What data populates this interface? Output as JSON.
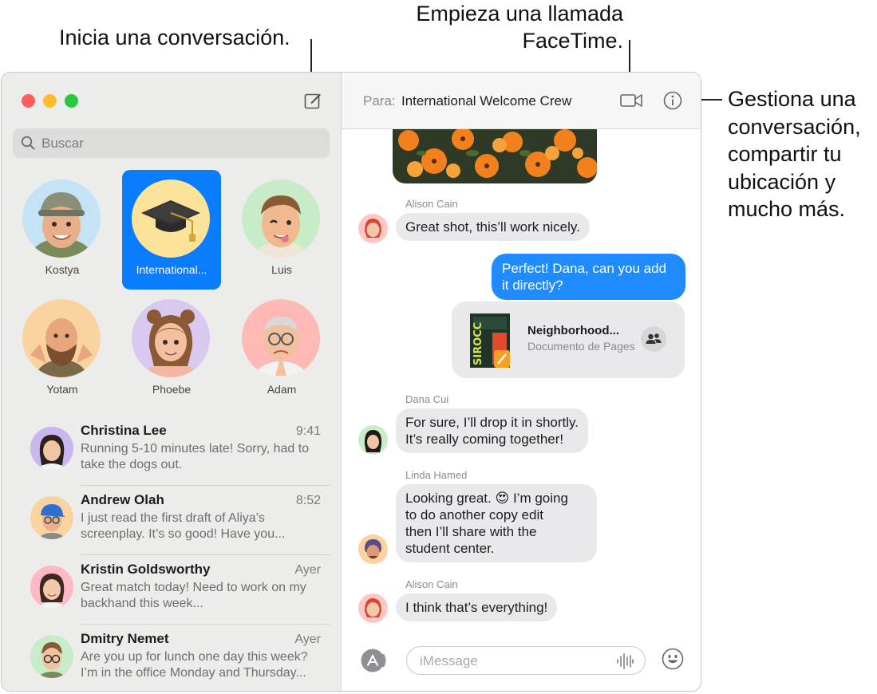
{
  "callouts": {
    "compose": "Inicia una conversación.",
    "facetime_line1": "Empieza una llamada",
    "facetime_line2": "FaceTime.",
    "info_line1": "Gestiona una",
    "info_line2": "conversación,",
    "info_line3": "compartir tu",
    "info_line4": "ubicación y",
    "info_line5": "mucho más."
  },
  "sidebar": {
    "search_placeholder": "Buscar",
    "pinned": [
      {
        "name": "Kostya"
      },
      {
        "name": "International..."
      },
      {
        "name": "Luis"
      },
      {
        "name": "Yotam"
      },
      {
        "name": "Phoebe"
      },
      {
        "name": "Adam"
      }
    ],
    "conversations": [
      {
        "name": "Christina Lee",
        "time": "9:41",
        "preview": "Running 5-10 minutes late! Sorry, had to take the dogs out."
      },
      {
        "name": "Andrew Olah",
        "time": "8:52",
        "preview": "I just read the first draft of Aliya’s screenplay. It’s so good! Have you..."
      },
      {
        "name": "Kristin Goldsworthy",
        "time": "Ayer",
        "preview": "Great match today! Need to work on my backhand this week..."
      },
      {
        "name": "Dmitry Nemet",
        "time": "Ayer",
        "preview": "Are you up for lunch one day this week? I’m in the office Monday and Thursday..."
      }
    ]
  },
  "header": {
    "to_label": "Para:",
    "recipient": "International Welcome Crew"
  },
  "thread": {
    "m1_sender": "Alison Cain",
    "m1_text": "Great shot, this’ll work nicely.",
    "m2_line1": "Perfect! Dana, can you add",
    "m2_line2": "it directly?",
    "doc_title": "Neighborhood...",
    "doc_subtitle": "Documento de Pages",
    "m3_sender": "Dana Cui",
    "m3_line1": "For sure, I’ll drop it in shortly.",
    "m3_line2": "It’s really coming together!",
    "m4_sender": "Linda Hamed",
    "m4_line1a": "Looking great.",
    "m4_emoji": "😍",
    "m4_line1b": "I’m going",
    "m4_line2": "to do another copy edit",
    "m4_line3": "then I’ll share with the",
    "m4_line4": "student center.",
    "m5_sender": "Alison Cain",
    "m5_text": "I think that’s everything!"
  },
  "composer": {
    "placeholder": "iMessage"
  },
  "colors": {
    "accent": "#0a7cff",
    "outgoing_bubble": "#1f8bff",
    "incoming_bubble": "#e9e9eb",
    "close": "#ff5f57",
    "minimize": "#febc2e",
    "maximize": "#28c840"
  },
  "icons": [
    "compose-icon",
    "search-icon",
    "video-camera-icon",
    "info-icon",
    "app-store-icon",
    "audio-waveform-icon",
    "emoji-icon",
    "collaborators-icon"
  ]
}
